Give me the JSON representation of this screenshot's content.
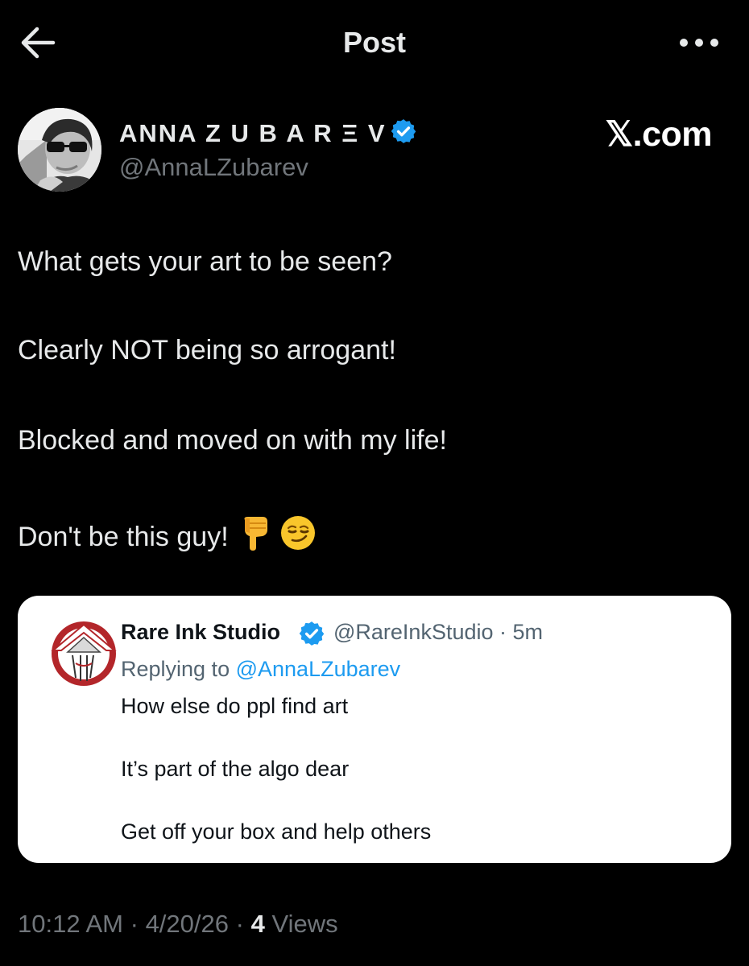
{
  "header": {
    "title": "Post",
    "back_icon": "arrow-left-icon",
    "more_icon": "more-horizontal-icon"
  },
  "author": {
    "display_name": "ANNA Z U B A R Ξ V",
    "handle": "@AnnaLZubarev",
    "verified": true,
    "verified_color": "#1d9bf0"
  },
  "site_mark": "𝕏.com",
  "post": {
    "lines": [
      "What gets your art to be seen?",
      "Clearly NOT being so arrogant!",
      "Blocked and moved on with my life!",
      "Don't be this guy!"
    ],
    "emojis": [
      "backhand-index-pointing-down-emoji",
      "smirking-face-emoji"
    ]
  },
  "quoted": {
    "name": "Rare Ink Studio",
    "verified": true,
    "handle_time": "@RareInkStudio · 5m",
    "replying_prefix": "Replying to",
    "replying_handle": "@AnnaLZubarev",
    "lines": [
      "How else do ppl find art",
      "It’s part of the algo dear",
      "Get off your box and help others"
    ],
    "avatar_color": "#b3262a"
  },
  "meta": {
    "time": "10:12 AM",
    "sep1": "·",
    "date": "4/20/26",
    "sep2": "·",
    "views_count": "4",
    "views_label": "Views"
  },
  "colors": {
    "background": "#000000",
    "text": "#e7e9ea",
    "muted": "#71767b",
    "accent": "#1d9bf0"
  }
}
